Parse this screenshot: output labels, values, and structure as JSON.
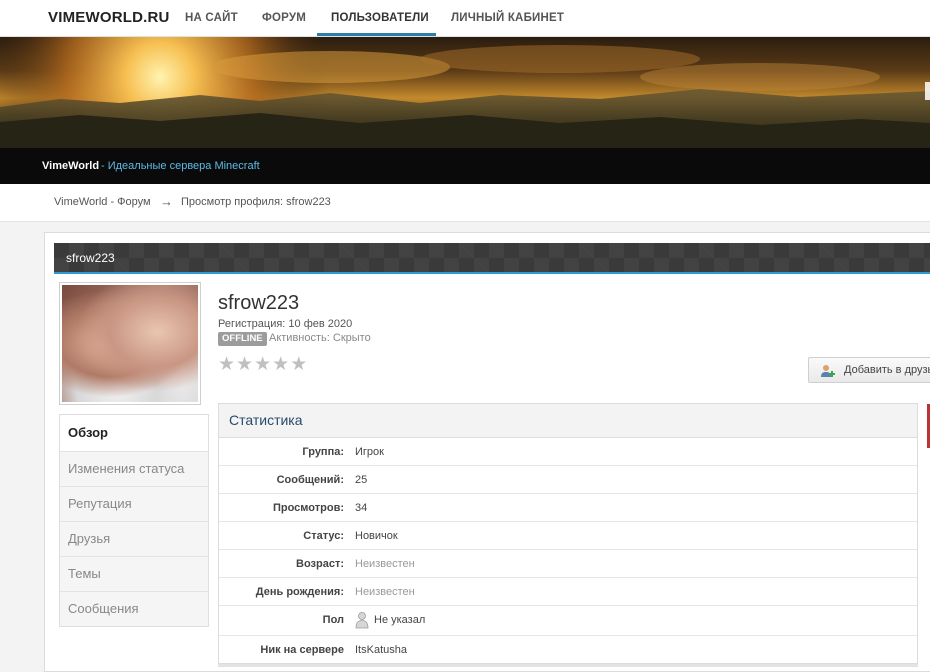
{
  "nav": {
    "logo": "VIMEWORLD.RU",
    "items": [
      {
        "label": "НА САЙТ"
      },
      {
        "label": "ФОРУМ"
      },
      {
        "label": "ПОЛЬЗОВАТЕЛИ"
      },
      {
        "label": "ЛИЧНЫЙ КАБИНЕТ"
      }
    ],
    "active_index": 2
  },
  "tagline": {
    "site": "VimeWorld",
    "rest": " - Идеальные сервера Minecraft"
  },
  "breadcrumb": {
    "items": [
      "VimeWorld - Форум",
      "Просмотр профиля: sfrow223"
    ],
    "separator": "→"
  },
  "profile": {
    "header_title": "sfrow223",
    "username": "sfrow223",
    "registration": "Регистрация: 10 фев 2020",
    "status_badge": "OFFLINE",
    "activity": "Активность: Скрыто",
    "rating_stars": 0,
    "add_friend_label": "Добавить в друзья"
  },
  "side_menu": {
    "items": [
      {
        "label": "Обзор"
      },
      {
        "label": "Изменения статуса"
      },
      {
        "label": "Репутация"
      },
      {
        "label": "Друзья"
      },
      {
        "label": "Темы"
      },
      {
        "label": "Сообщения"
      }
    ],
    "active_index": 0
  },
  "stats": {
    "title": "Статистика",
    "rows": [
      {
        "label": "Группа:",
        "value": "Игрок"
      },
      {
        "label": "Сообщений:",
        "value": "25"
      },
      {
        "label": "Просмотров:",
        "value": "34"
      },
      {
        "label": "Статус:",
        "value": "Новичок"
      },
      {
        "label": "Возраст:",
        "value": "Неизвестен"
      },
      {
        "label": "День рождения:",
        "value": "Неизвестен"
      },
      {
        "label": "Пол",
        "value": "Не указал"
      },
      {
        "label": "Ник на сервере",
        "value": "ItsKatusha"
      }
    ]
  },
  "colors": {
    "accent_blue": "#2c7fa8",
    "header_dark": "#3a3a3a",
    "tagline_blue": "#5dbbe6",
    "offline_grey": "#9c9c9c"
  },
  "icons": {
    "add_friend": "user-add-icon",
    "gender": "person-icon",
    "rating": "star-icon",
    "separator": "arrow-right-icon"
  }
}
